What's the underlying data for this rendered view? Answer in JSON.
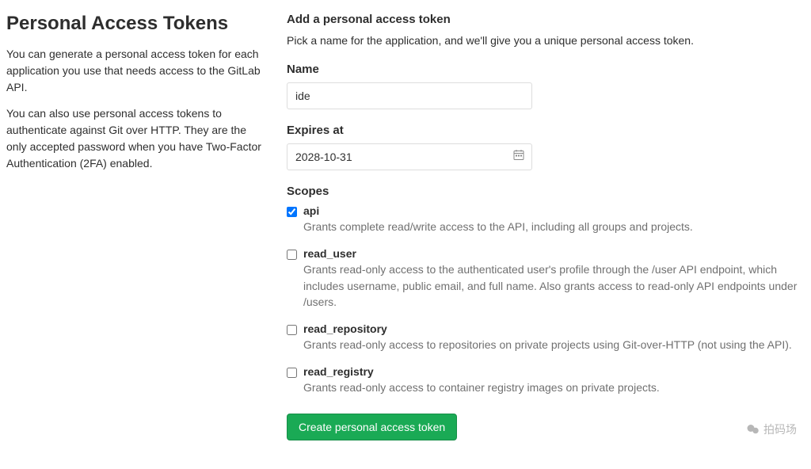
{
  "left": {
    "title": "Personal Access Tokens",
    "desc1": "You can generate a personal access token for each application you use that needs access to the GitLab API.",
    "desc2": "You can also use personal access tokens to authenticate against Git over HTTP. They are the only accepted password when you have Two-Factor Authentication (2FA) enabled."
  },
  "form": {
    "section_title": "Add a personal access token",
    "intro": "Pick a name for the application, and we'll give you a unique personal access token.",
    "name_label": "Name",
    "name_value": "ide",
    "expires_label": "Expires at",
    "expires_value": "2028-10-31",
    "scopes_label": "Scopes",
    "button": "Create personal access token"
  },
  "scopes": [
    {
      "name": "api",
      "checked": true,
      "desc": "Grants complete read/write access to the API, including all groups and projects."
    },
    {
      "name": "read_user",
      "checked": false,
      "desc": "Grants read-only access to the authenticated user's profile through the /user API endpoint, which includes username, public email, and full name. Also grants access to read-only API endpoints under /users."
    },
    {
      "name": "read_repository",
      "checked": false,
      "desc": "Grants read-only access to repositories on private projects using Git-over-HTTP (not using the API)."
    },
    {
      "name": "read_registry",
      "checked": false,
      "desc": "Grants read-only access to container registry images on private projects."
    }
  ],
  "watermark": {
    "text": "拍码场"
  }
}
